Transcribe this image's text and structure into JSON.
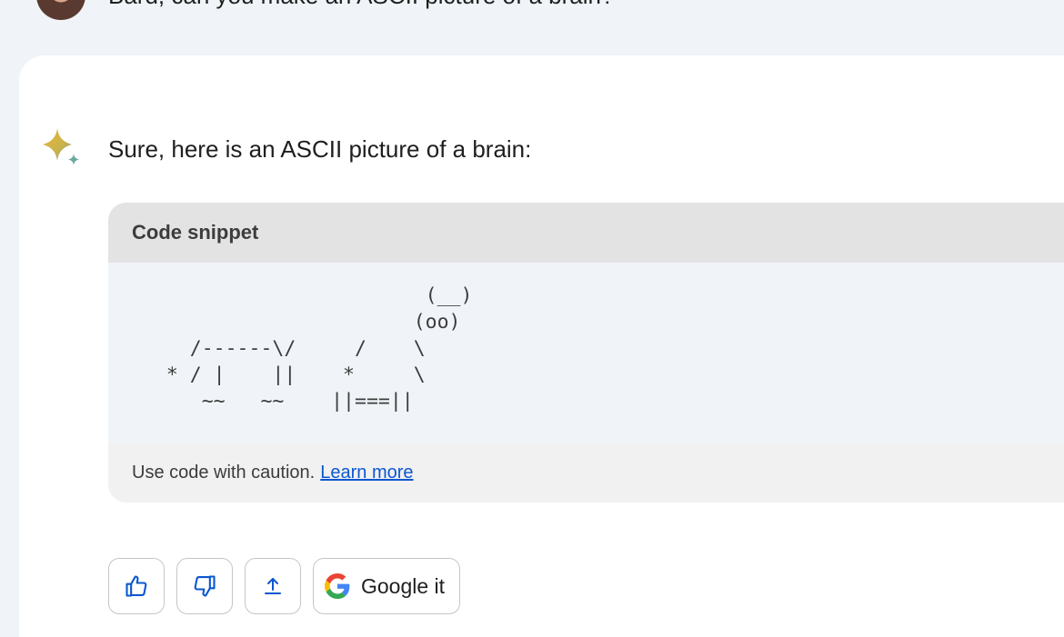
{
  "user": {
    "prompt": "Bard, can you make an ASCII picture of a brain?",
    "avatar_icon": "user-avatar"
  },
  "response": {
    "icon": "sparkle-icon",
    "intro": "Sure, here is an ASCII picture of a brain:",
    "code": {
      "header": "Code snippet",
      "content": "                        (__)\n                       (oo)\n    /------\\/     /    \\\n  * / |    ||    *     \\\n     ~~   ~~    ||===||",
      "caution": "Use code with caution.",
      "learn_more": "Learn more"
    }
  },
  "actions": {
    "thumbs_up_icon": "thumbs-up-icon",
    "thumbs_down_icon": "thumbs-down-icon",
    "share_icon": "share-icon",
    "google_icon": "google-g-icon",
    "google_it": "Google it"
  },
  "colors": {
    "page_bg": "#f0f4f9",
    "card_bg": "#ffffff",
    "code_header_bg": "#e3e3e3",
    "link": "#0b57d0"
  }
}
